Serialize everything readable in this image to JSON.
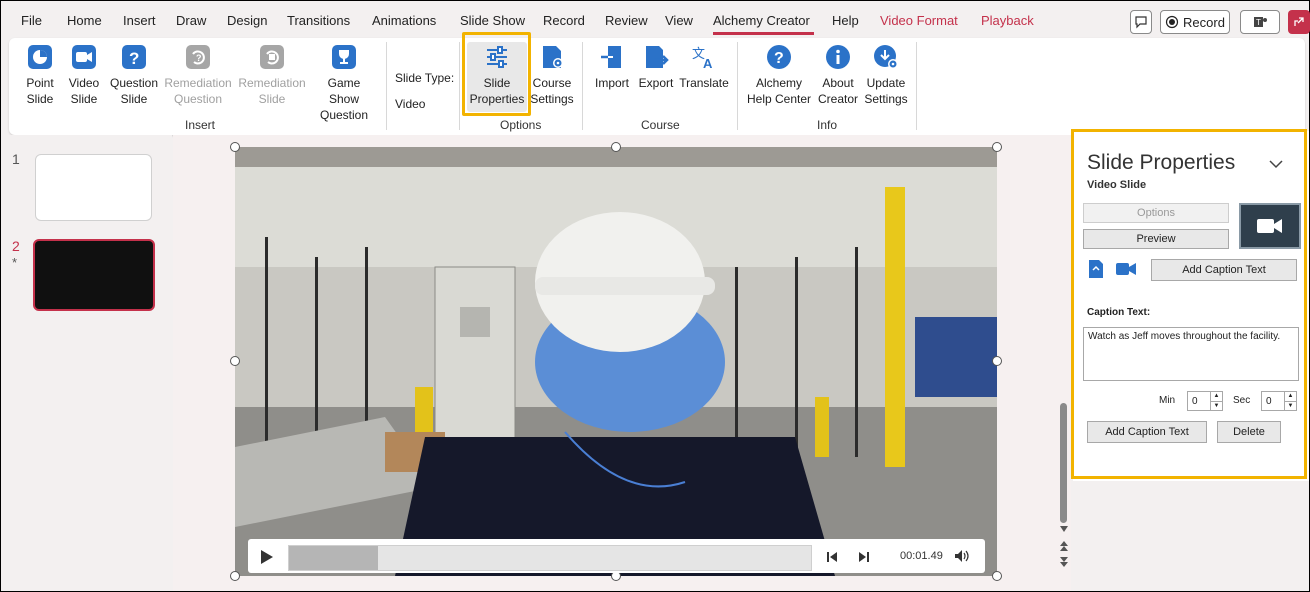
{
  "menu": {
    "items": [
      "File",
      "Home",
      "Insert",
      "Draw",
      "Design",
      "Transitions",
      "Animations",
      "Slide Show",
      "Record",
      "Review",
      "View",
      "Alchemy Creator",
      "Help",
      "Video Format",
      "Playback"
    ],
    "active": "Alchemy Creator",
    "record_label": "Record"
  },
  "ribbon": {
    "insert_group": {
      "label": "Insert",
      "buttons": [
        {
          "line1": "Point",
          "line2": "Slide",
          "icon": "pie-chart-icon"
        },
        {
          "line1": "Video",
          "line2": "Slide",
          "icon": "video-camera-icon"
        },
        {
          "line1": "Question",
          "line2": "Slide",
          "icon": "question-icon"
        },
        {
          "line1": "Remediation",
          "line2": "Question",
          "icon": "remediation-question-icon",
          "disabled": true
        },
        {
          "line1": "Remediation",
          "line2": "Slide",
          "icon": "remediation-slide-icon",
          "disabled": true
        },
        {
          "line1": "Game Show",
          "line2": "Question",
          "icon": "trophy-icon"
        }
      ]
    },
    "slide_type": {
      "label": "Slide Type:",
      "value": "Video"
    },
    "options_group": {
      "label": "Options",
      "buttons": [
        {
          "line1": "Slide",
          "line2": "Properties",
          "icon": "sliders-icon"
        },
        {
          "line1": "Course",
          "line2": "Settings",
          "icon": "document-gear-icon"
        }
      ]
    },
    "course_group": {
      "label": "Course",
      "buttons": [
        {
          "line1": "Import",
          "icon": "import-icon"
        },
        {
          "line1": "Export",
          "icon": "export-icon"
        },
        {
          "line1": "Translate",
          "icon": "translate-icon"
        }
      ]
    },
    "info_group": {
      "label": "Info",
      "buttons": [
        {
          "line1": "Alchemy",
          "line2": "Help Center",
          "icon": "help-icon"
        },
        {
          "line1": "About",
          "line2": "Creator",
          "icon": "info-icon"
        },
        {
          "line1": "Update",
          "line2": "Settings",
          "icon": "update-gear-icon"
        }
      ]
    }
  },
  "thumbnails": [
    {
      "number": "1"
    },
    {
      "number": "2",
      "star": "*"
    }
  ],
  "player": {
    "time": "00:01.49",
    "progress": 0.17
  },
  "pane": {
    "title": "Slide Properties",
    "subtitle": "Video Slide",
    "options_label": "Options",
    "preview_label": "Preview",
    "add_caption_top": "Add Caption Text",
    "caption_label": "Caption Text:",
    "caption_text": "Watch as Jeff moves throughout the facility.",
    "min_label": "Min",
    "min_value": "0",
    "sec_label": "Sec",
    "sec_value": "0",
    "add_caption_bottom": "Add Caption Text",
    "delete_label": "Delete"
  },
  "colors": {
    "accent": "#c4314b",
    "highlight": "#f2b300",
    "icon_blue": "#2b72c8"
  }
}
